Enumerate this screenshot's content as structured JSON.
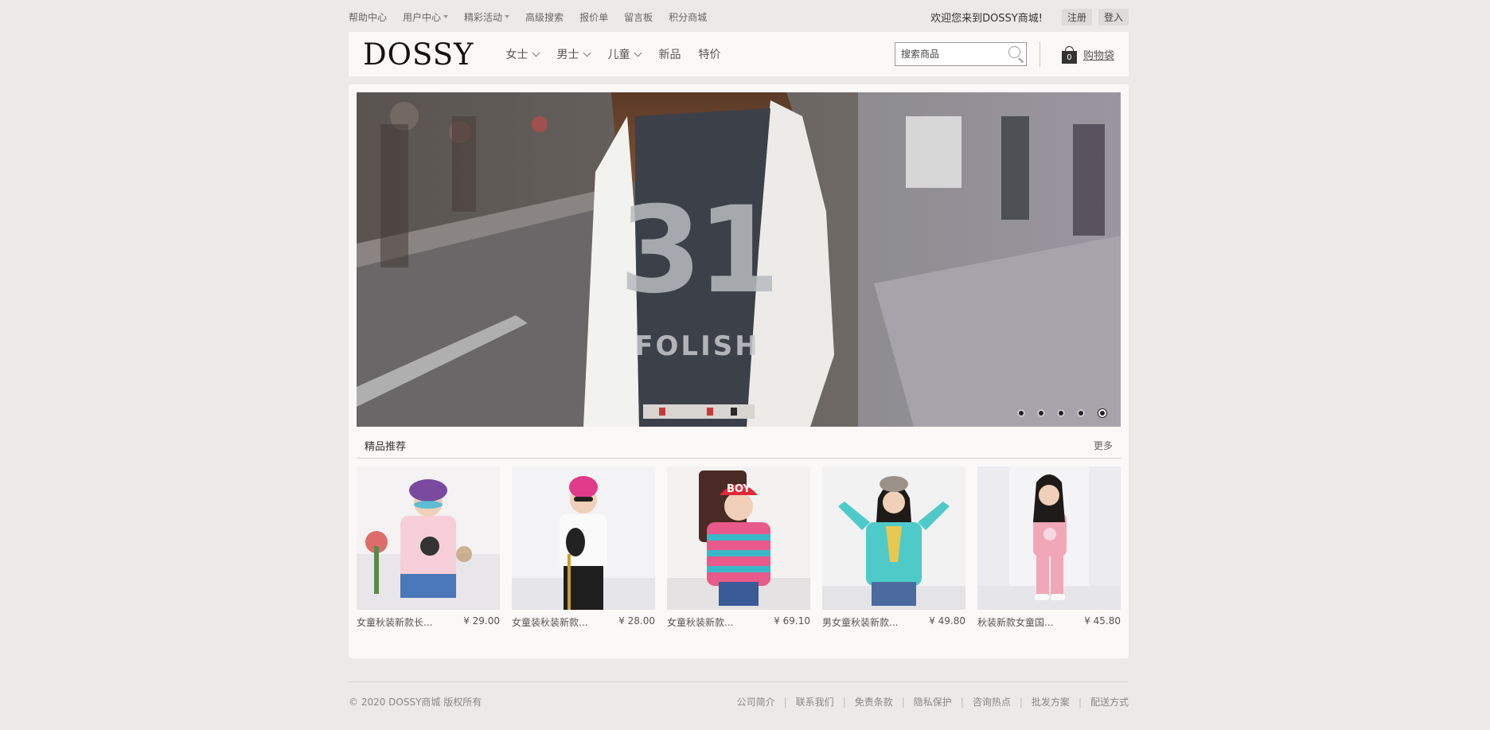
{
  "topbar": {
    "links": [
      {
        "label": "帮助中心",
        "caret": false
      },
      {
        "label": "用户中心",
        "caret": true
      },
      {
        "label": "精彩活动",
        "caret": true
      },
      {
        "label": "高级搜索",
        "caret": false
      },
      {
        "label": "报价单",
        "caret": false
      },
      {
        "label": "留言板",
        "caret": false
      },
      {
        "label": "积分商城",
        "caret": false
      }
    ],
    "welcome": "欢迎您来到DOSSY商城!",
    "register_label": "注册",
    "login_label": "登入"
  },
  "header": {
    "logo": "DOSSY",
    "nav": [
      {
        "label": "女士",
        "dropdown": true
      },
      {
        "label": "男士",
        "dropdown": true
      },
      {
        "label": "儿童",
        "dropdown": true
      },
      {
        "label": "新品",
        "dropdown": false
      },
      {
        "label": "特价",
        "dropdown": false
      }
    ],
    "search_placeholder": "搜索商品",
    "cart_count": "0",
    "cart_label": "购物袋"
  },
  "banner": {
    "slide_count": 5,
    "active_index": 4
  },
  "featured": {
    "title": "精品推荐",
    "more_label": "更多",
    "products": [
      {
        "name": "女童秋装新款长...",
        "price": "¥ 29.00"
      },
      {
        "name": "女童装秋装新款...",
        "price": "¥ 28.00"
      },
      {
        "name": "女童秋装新款...",
        "price": "¥ 69.10"
      },
      {
        "name": "男女童秋装新款...",
        "price": "¥ 49.80"
      },
      {
        "name": "秋装新款女童国...",
        "price": "¥ 45.80"
      }
    ]
  },
  "footer": {
    "copyright": "© 2020 DOSSY商城 版权所有",
    "links": [
      "公司简介",
      "联系我们",
      "免责条款",
      "隐私保护",
      "咨询热点",
      "批发方案",
      "配送方式"
    ]
  }
}
